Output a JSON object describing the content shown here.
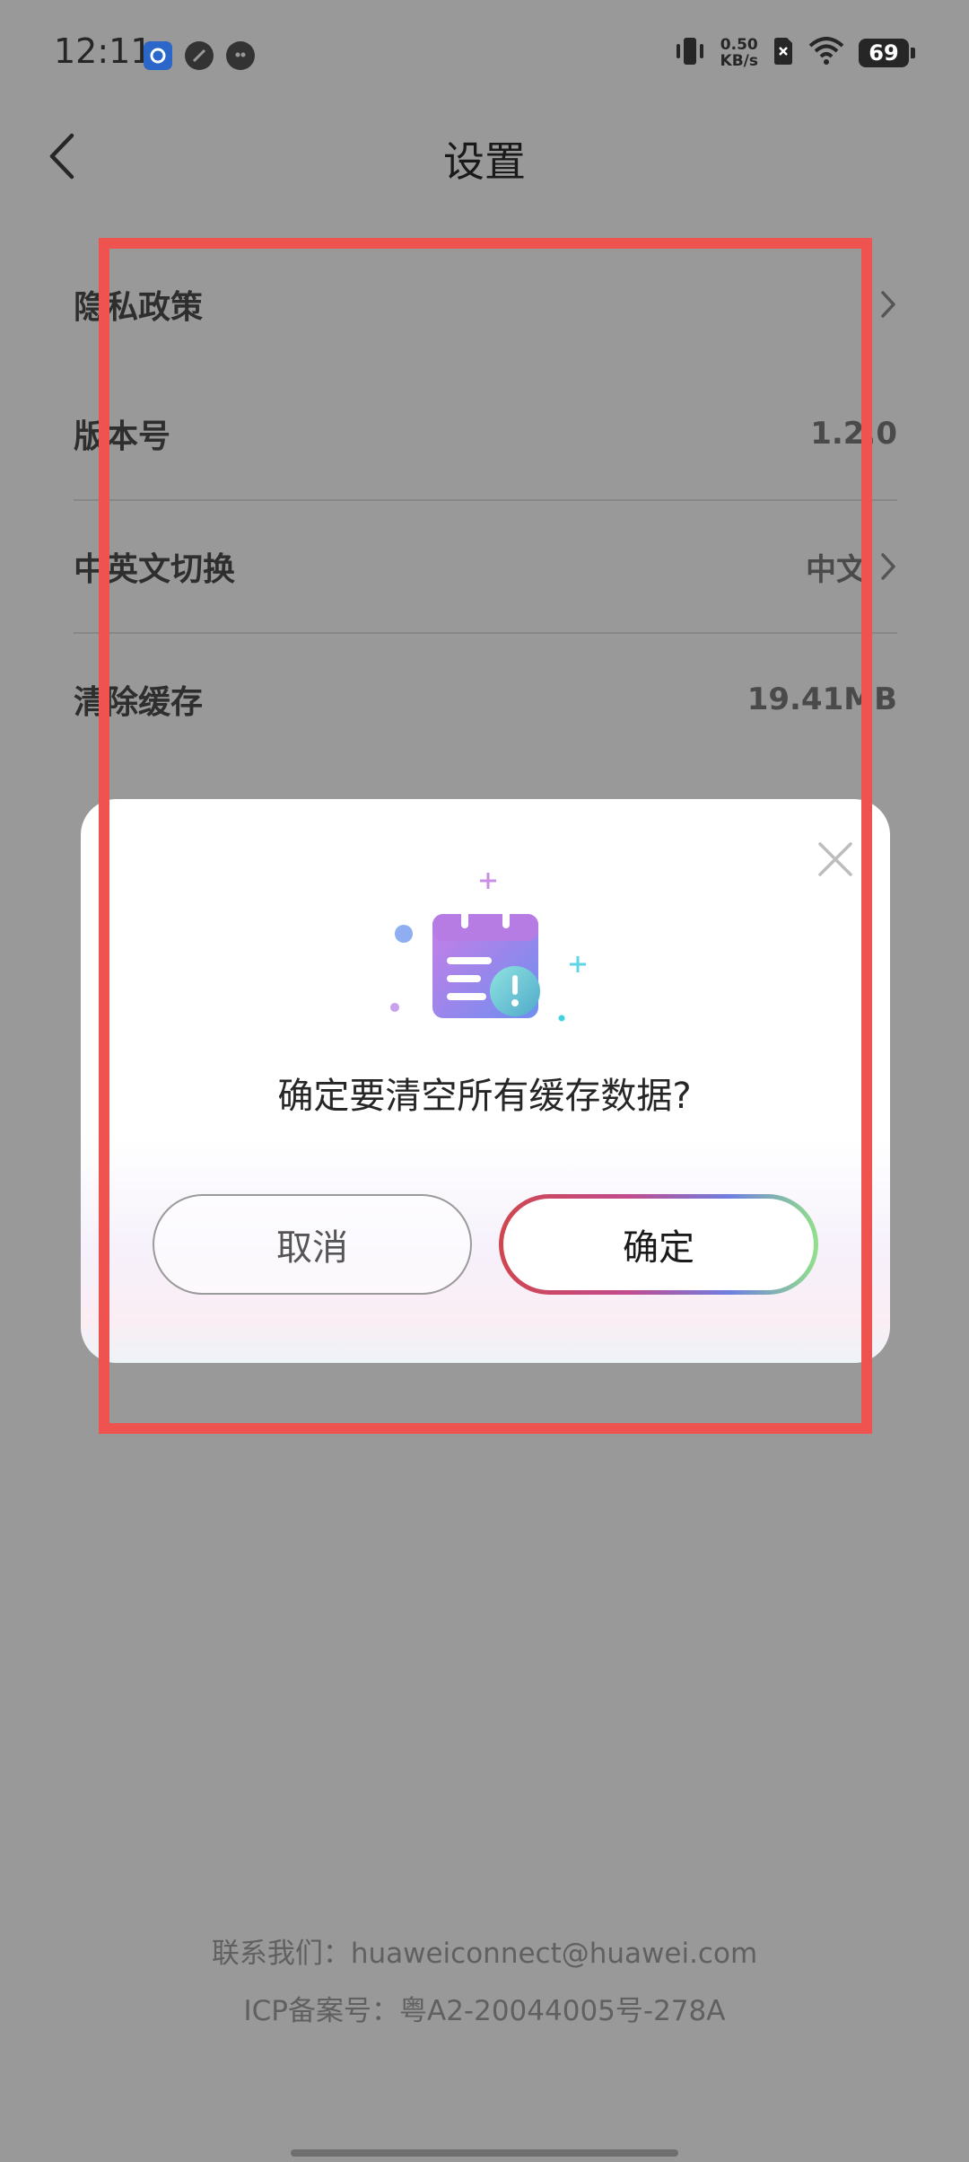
{
  "status_bar": {
    "time": "12:11",
    "net_speed_value": "0.50",
    "net_speed_unit": "KB/s",
    "battery": "69"
  },
  "header": {
    "title": "设置"
  },
  "settings": [
    {
      "label": "隐私政策",
      "value": ""
    },
    {
      "label": "版本号",
      "value": "1.2.0"
    },
    {
      "label": "中英文切换",
      "value": "中文"
    },
    {
      "label": "清除缓存",
      "value": "19.41MB"
    }
  ],
  "dialog": {
    "message": "确定要清空所有缓存数据?",
    "cancel_label": "取消",
    "confirm_label": "确定"
  },
  "footer": {
    "contact": "联系我们：huaweiconnect@huawei.com",
    "icp": "ICP备案号：粤A2-20044005号-278A"
  },
  "colors": {
    "overlay": "#999999",
    "highlight": "#ef5350"
  }
}
